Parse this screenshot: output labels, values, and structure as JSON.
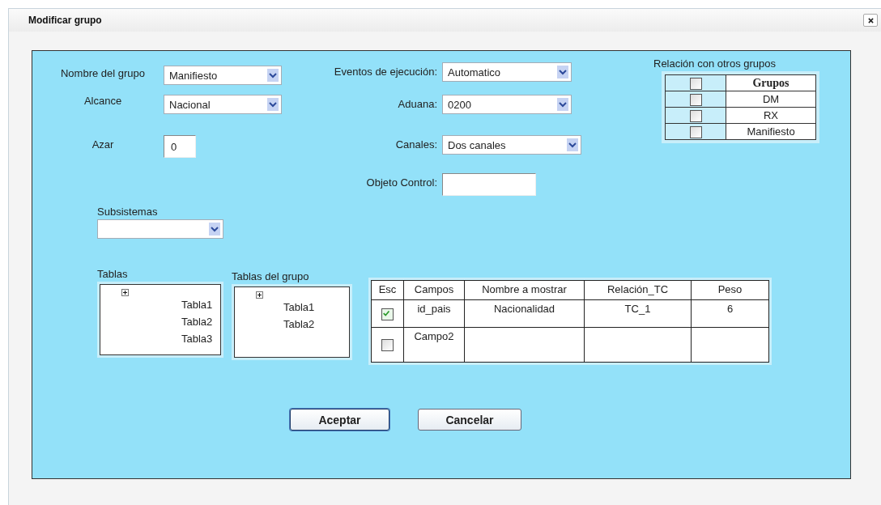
{
  "dialog": {
    "title": "Modificar grupo"
  },
  "fields_left": [
    {
      "label": "Nombre del grupo",
      "kind": "select",
      "value": "Manifiesto"
    },
    {
      "label": "Alcance",
      "kind": "select",
      "value": "Nacional"
    },
    {
      "label": "Azar",
      "kind": "input",
      "value": "0"
    }
  ],
  "fields_right": [
    {
      "label": "Eventos de ejecución:",
      "kind": "select",
      "value": "Automatico"
    },
    {
      "label": "Aduana:",
      "kind": "select",
      "value": "0200"
    },
    {
      "label": "Canales:",
      "kind": "select",
      "value": "Dos canales"
    },
    {
      "label": "Objeto Control:",
      "kind": "input"
    }
  ],
  "relacion": {
    "title": "Relación con otros grupos",
    "header": {
      "label": "Grupos",
      "checked": false
    },
    "rows": [
      {
        "label": "DM",
        "checked": false
      },
      {
        "label": "RX",
        "checked": false
      },
      {
        "label": "Manifiesto",
        "checked": false
      }
    ]
  },
  "subsistemas": {
    "label": "Subsistemas"
  },
  "tablas": {
    "label": "Tablas",
    "items": [
      "Tabla1",
      "Tabla2",
      "Tabla3"
    ]
  },
  "tablas_grupo": {
    "label": "Tablas del grupo",
    "items": [
      "Tabla1",
      "Tabla2"
    ]
  },
  "campos": {
    "columns": [
      "Esc",
      "Campos",
      "Nombre a mostrar",
      "Relación_TC",
      "Peso"
    ],
    "rows": [
      {
        "checked": true,
        "cells": [
          "",
          "id_pais",
          "Nacionalidad",
          "TC_1",
          "6"
        ]
      },
      {
        "checked": false,
        "cells": [
          "",
          "Campo2"
        ]
      }
    ]
  },
  "buttons": [
    {
      "label": "Aceptar",
      "focused": true
    },
    {
      "label": "Cancelar",
      "focused": false
    }
  ]
}
